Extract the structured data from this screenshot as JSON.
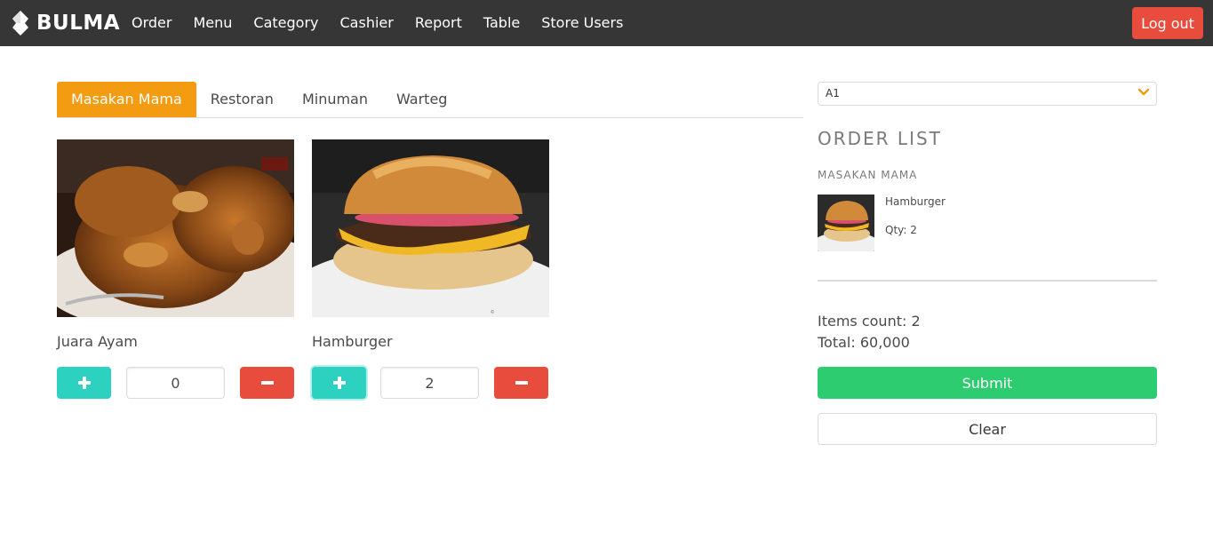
{
  "navbar": {
    "brand": "BULMA",
    "items": [
      {
        "label": "Order"
      },
      {
        "label": "Menu"
      },
      {
        "label": "Category"
      },
      {
        "label": "Cashier"
      },
      {
        "label": "Report"
      },
      {
        "label": "Table"
      },
      {
        "label": "Store Users"
      }
    ],
    "logout_label": "Log out"
  },
  "tabs": [
    {
      "label": "Masakan Mama",
      "active": true
    },
    {
      "label": "Restoran",
      "active": false
    },
    {
      "label": "Minuman",
      "active": false
    },
    {
      "label": "Warteg",
      "active": false
    }
  ],
  "products": [
    {
      "name": "Juara Ayam",
      "qty": "0",
      "image": "fried-chicken-photo"
    },
    {
      "name": "Hamburger",
      "qty": "2",
      "image": "hamburger-photo"
    }
  ],
  "sidebar": {
    "table_select": "A1",
    "order_title": "ORDER LIST",
    "category": "MASAKAN MAMA",
    "order_items": [
      {
        "name": "Hamburger",
        "qty_text": "Qty: 2",
        "image": "hamburger-photo"
      }
    ],
    "items_count": "Items count: 2",
    "total": "Total: 60,000",
    "submit_label": "Submit",
    "clear_label": "Clear"
  },
  "colors": {
    "navbar_bg": "#363636",
    "active_tab": "#f39c12",
    "plus_button": "#2dd1bf",
    "minus_button": "#e74c3c",
    "logout_button": "#e74c3c",
    "submit_button": "#2ecc71",
    "select_arrow": "#f39c12"
  },
  "icons": {
    "brand": "bulma-logo-icon",
    "plus": "plus-icon",
    "minus": "minus-icon",
    "select": "chevron-down-icon"
  }
}
